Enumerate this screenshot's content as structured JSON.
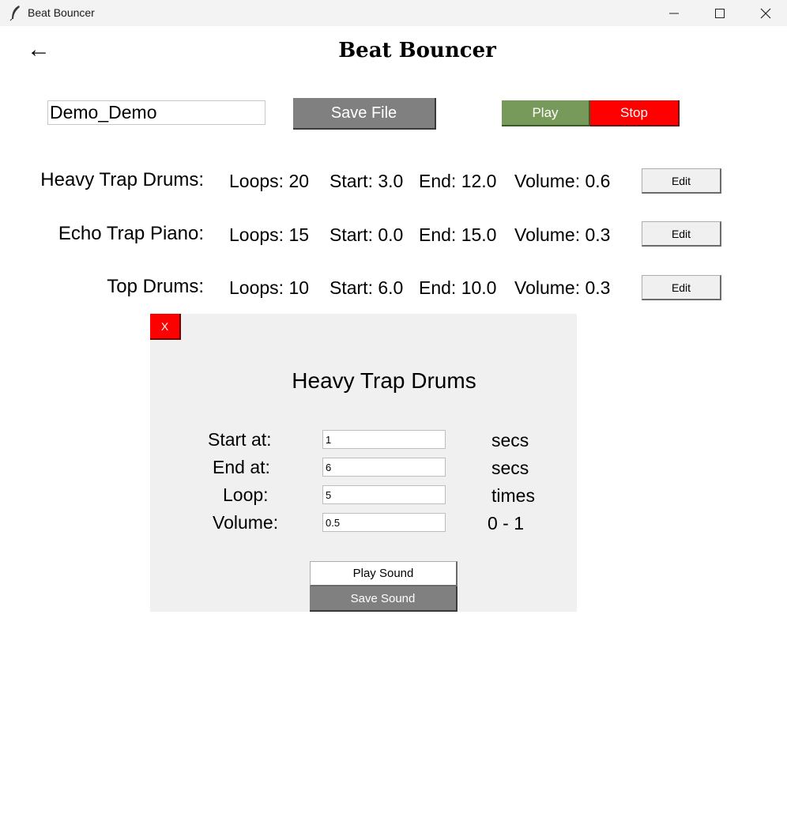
{
  "window": {
    "title": "Beat Bouncer",
    "icon": "feather-icon",
    "controls": [
      "minimize-icon",
      "maximize-icon",
      "close-icon"
    ]
  },
  "header": {
    "back_glyph": "←",
    "title": "Beat Bouncer"
  },
  "file": {
    "name_value": "Demo_Demo",
    "save_label": "Save File"
  },
  "transport": {
    "play_label": "Play",
    "stop_label": "Stop"
  },
  "tracks": [
    {
      "name": "Heavy Trap Drums:",
      "loops": "Loops: 20",
      "start": "Start: 3.0",
      "end": "End: 12.0",
      "volume": "Volume: 0.6",
      "edit_label": "Edit"
    },
    {
      "name": "Echo Trap Piano:",
      "loops": "Loops: 15",
      "start": "Start: 0.0",
      "end": "End: 15.0",
      "volume": "Volume: 0.3",
      "edit_label": "Edit"
    },
    {
      "name": "Top Drums:",
      "loops": "Loops: 10",
      "start": "Start: 6.0",
      "end": "End: 10.0",
      "volume": "Volume: 0.3",
      "edit_label": "Edit"
    }
  ],
  "editor": {
    "close_label": "X",
    "title": "Heavy Trap Drums",
    "fields": [
      {
        "label": "Start at:",
        "value": "1",
        "unit": "secs"
      },
      {
        "label": "End at:",
        "value": "6",
        "unit": "secs"
      },
      {
        "label": "Loop:",
        "value": "5",
        "unit": "times"
      },
      {
        "label": "Volume:",
        "value": "0.5",
        "unit": "0 - 1"
      }
    ],
    "play_sound_label": "Play Sound",
    "save_sound_label": "Save Sound"
  },
  "colors": {
    "play": "#779a5a",
    "stop": "#ff0000",
    "save": "#808080",
    "panel": "#f0f0f0"
  }
}
